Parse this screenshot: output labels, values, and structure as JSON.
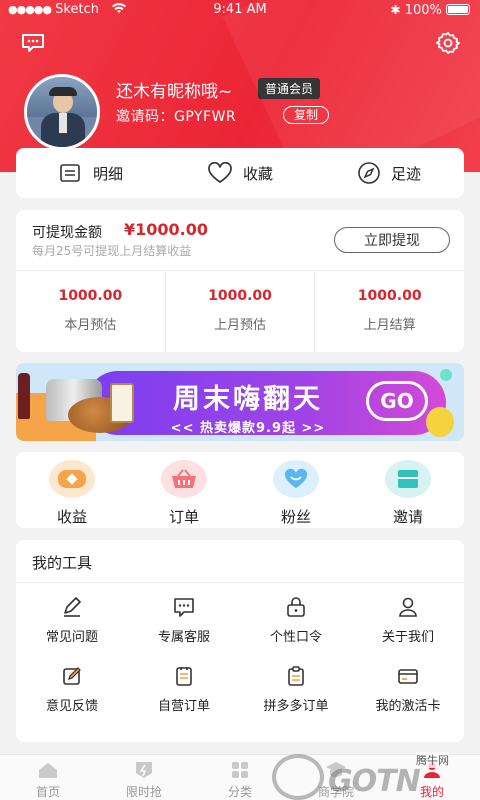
{
  "status_bar": {
    "carrier": "Sketch",
    "time": "9:41 AM",
    "battery": "100%"
  },
  "profile": {
    "name": "还木有昵称哦~",
    "badge": "普通会员",
    "invite_label": "邀请码：GPYFWR",
    "copy_label": "复制"
  },
  "quick_tabs": [
    {
      "label": "明细",
      "icon": "list-icon"
    },
    {
      "label": "收藏",
      "icon": "heart-icon"
    },
    {
      "label": "足迹",
      "icon": "compass-icon"
    }
  ],
  "earnings": {
    "title": "可提现金额",
    "amount": "¥1000.00",
    "subtitle": "每月25号可提现上月结算收益",
    "withdraw_label": "立即提现",
    "stats": [
      {
        "value": "1000.00",
        "label": "本月预估"
      },
      {
        "value": "1000.00",
        "label": "上月预估"
      },
      {
        "value": "1000.00",
        "label": "上月结算"
      }
    ]
  },
  "banner": {
    "title": "周末嗨翻天",
    "subtitle": "<< 热卖爆款9.9起 >>",
    "go": "GO"
  },
  "shortcuts": [
    {
      "label": "收益",
      "icon": "wallet-icon",
      "color": "#f7a34a"
    },
    {
      "label": "订单",
      "icon": "basket-icon",
      "color": "#f2727b"
    },
    {
      "label": "粉丝",
      "icon": "heart-fans-icon",
      "color": "#5ab6f0"
    },
    {
      "label": "邀请",
      "icon": "invite-icon",
      "color": "#33c2b7"
    }
  ],
  "tools": {
    "title": "我的工具",
    "items": [
      {
        "label": "常见问题",
        "icon": "pencil-icon"
      },
      {
        "label": "专属客服",
        "icon": "chat-icon"
      },
      {
        "label": "个性口令",
        "icon": "lock-icon"
      },
      {
        "label": "关于我们",
        "icon": "person-icon"
      },
      {
        "label": "意见反馈",
        "icon": "edit-icon"
      },
      {
        "label": "自营订单",
        "icon": "order-icon"
      },
      {
        "label": "拼多多订单",
        "icon": "clipboard-icon"
      },
      {
        "label": "我的激活卡",
        "icon": "card-icon"
      }
    ]
  },
  "tab_bar": [
    {
      "label": "首页"
    },
    {
      "label": "限时抢"
    },
    {
      "label": "分类"
    },
    {
      "label": "商学院"
    },
    {
      "label": "我的"
    }
  ],
  "watermark": {
    "text": "腾牛网"
  },
  "colors": {
    "brand_red": "#ec2535",
    "price_red": "#d4272f",
    "text_gray": "#999999"
  }
}
